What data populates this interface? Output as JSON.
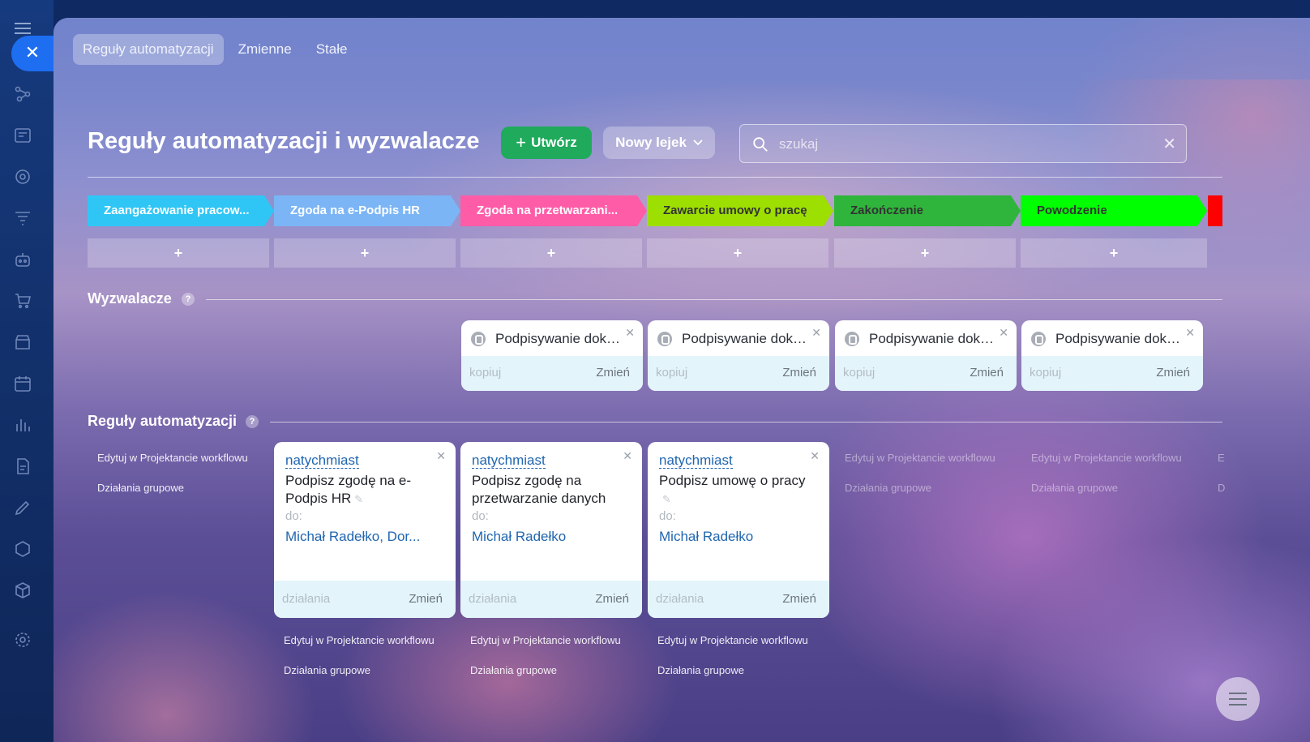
{
  "tabs": [
    "Reguły automatyzacji",
    "Zmienne",
    "Stałe"
  ],
  "header": {
    "title": "Reguły automatyzacji i wyzwalacze",
    "create_label": "Utwórz",
    "funnel_label": "Nowy lejek",
    "search_placeholder": "szukaj"
  },
  "stages": [
    {
      "label": "Zaangażowanie pracow...",
      "color": "#2fc6f6",
      "text_color": "#ffffff"
    },
    {
      "label": "Zgoda na e-Podpis HR",
      "color": "#7bb5f5",
      "text_color": "#ffffff"
    },
    {
      "label": "Zgoda na przetwarzani...",
      "color": "#ff5ca8",
      "text_color": "#ffffff"
    },
    {
      "label": "Zawarcie umowy o pracę",
      "color": "#9ddf00",
      "text_color": "#333333"
    },
    {
      "label": "Zakończenie",
      "color": "#2fb53b",
      "text_color": "#333333"
    },
    {
      "label": "Powodzenie",
      "color": "#00ff00",
      "text_color": "#333333"
    }
  ],
  "add_label": "+",
  "triggers": {
    "title": "Wyzwalacze",
    "help": "?",
    "cards": [
      {
        "label": "Podpisywanie doku...",
        "copy": "kopiuj",
        "change": "Zmień"
      },
      {
        "label": "Podpisywanie doku...",
        "copy": "kopiuj",
        "change": "Zmień"
      },
      {
        "label": "Podpisywanie doku...",
        "copy": "kopiuj",
        "change": "Zmień"
      },
      {
        "label": "Podpisywanie doku...",
        "copy": "kopiuj",
        "change": "Zmień"
      }
    ]
  },
  "robots": {
    "title": "Reguły automatyzacji",
    "help": "?",
    "edit_link": "Edytuj w Projektancie workflowu",
    "group_link": "Działania grupowe",
    "cards": [
      {
        "when": "natychmiast",
        "title": "Podpisz zgodę na e-Podpis HR",
        "to": "do:",
        "who": "Michał Radełko, Dor...",
        "actions": "działania",
        "change": "Zmień"
      },
      {
        "when": "natychmiast",
        "title": "Podpisz zgodę na przetwarzanie danych",
        "to": "do:",
        "who": "Michał Radełko",
        "actions": "działania",
        "change": "Zmień"
      },
      {
        "when": "natychmiast",
        "title": "Podpisz umowę o pracy",
        "to": "do:",
        "who": "Michał Radełko",
        "actions": "działania",
        "change": "Zmień"
      }
    ],
    "cut_letter_1": "E",
    "cut_letter_2": "D"
  },
  "icons": {
    "close": "close-icon",
    "search": "search-icon",
    "clear": "clear-icon",
    "chevron": "chevron-down-icon",
    "trigger": "document-sign-icon",
    "edit": "pencil-icon"
  }
}
